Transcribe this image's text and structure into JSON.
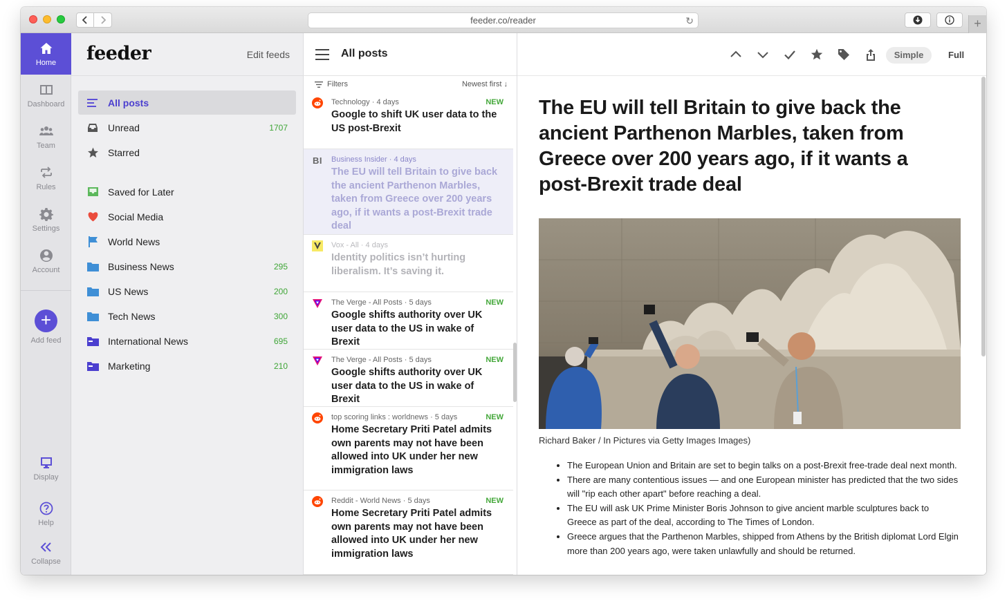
{
  "browser": {
    "url": "feeder.co/reader"
  },
  "rail": {
    "items": [
      {
        "label": "Home",
        "icon": "home-icon"
      },
      {
        "label": "Dashboard",
        "icon": "dashboard-icon"
      },
      {
        "label": "Team",
        "icon": "team-icon"
      },
      {
        "label": "Rules",
        "icon": "rules-icon"
      },
      {
        "label": "Settings",
        "icon": "gear-icon"
      },
      {
        "label": "Account",
        "icon": "account-icon"
      }
    ],
    "add_feed": "Add feed",
    "bottom": [
      {
        "label": "Display",
        "icon": "monitor-icon"
      },
      {
        "label": "Help",
        "icon": "help-icon"
      },
      {
        "label": "Collapse",
        "icon": "double-chevron-left-icon"
      }
    ]
  },
  "sidebar": {
    "logo": "feeder",
    "edit_feeds": "Edit feeds",
    "items": [
      {
        "label": "All posts",
        "count": "",
        "icon": "all-posts-icon"
      },
      {
        "label": "Unread",
        "count": "1707",
        "icon": "inbox-icon"
      },
      {
        "label": "Starred",
        "count": "",
        "icon": "star-icon"
      },
      {
        "label": "Saved for Later",
        "count": "",
        "icon": "saved-tray-icon"
      },
      {
        "label": "Social Media",
        "count": "",
        "icon": "heart-icon"
      },
      {
        "label": "World News",
        "count": "",
        "icon": "flag-icon"
      },
      {
        "label": "Business News",
        "count": "295",
        "icon": "folder-icon"
      },
      {
        "label": "US News",
        "count": "200",
        "icon": "folder-icon"
      },
      {
        "label": "Tech News",
        "count": "300",
        "icon": "folder-icon"
      },
      {
        "label": "International News",
        "count": "695",
        "icon": "folder-dark-icon"
      },
      {
        "label": "Marketing",
        "count": "210",
        "icon": "folder-dark-icon"
      }
    ],
    "colors": {
      "accent": "#5c4fd6",
      "count": "#3ea536"
    }
  },
  "posts": {
    "title": "All posts",
    "filters": "Filters",
    "sort": "Newest first ↓",
    "new_label": "NEW",
    "items": [
      {
        "source": "Technology",
        "age": "4 days",
        "is_new": true,
        "title": "Google to shift UK user data to the US post-Brexit",
        "icon": "reddit-icon"
      },
      {
        "source": "Business Insider",
        "age": "4 days",
        "is_new": false,
        "title": "The EU will tell Britain to give back the ancient Parthenon Marbles, taken from Greece over 200 years ago, if it wants a post-Brexit trade deal",
        "icon": "business-insider-icon"
      },
      {
        "source": "Vox - All",
        "age": "4 days",
        "is_new": false,
        "title": "Identity politics isn’t hurting liberalism. It’s saving it.",
        "icon": "vox-icon"
      },
      {
        "source": "The Verge - All Posts",
        "age": "5 days",
        "is_new": true,
        "title": "Google shifts authority over UK user data to the US in wake of Brexit",
        "icon": "verge-icon"
      },
      {
        "source": "The Verge - All Posts",
        "age": "5 days",
        "is_new": true,
        "title": "Google shifts authority over UK user data to the US in wake of Brexit",
        "icon": "verge-icon"
      },
      {
        "source": "top scoring links : worldnews",
        "age": "5 days",
        "is_new": true,
        "title": "Home Secretary Priti Patel admits own parents may not have been allowed into UK under her new immigration laws",
        "icon": "reddit-icon"
      },
      {
        "source": "Reddit - World News",
        "age": "5 days",
        "is_new": true,
        "title": "Home Secretary Priti Patel admits own parents may not have been allowed into UK under her new immigration laws",
        "icon": "reddit-icon"
      }
    ]
  },
  "reader": {
    "mode_simple": "Simple",
    "mode_full": "Full",
    "title": "The EU will tell Britain to give back the ancient Parthenon Marbles, taken from Greece over 200 years ago, if it wants a post-Brexit trade deal",
    "caption": "Richard Baker / In Pictures via Getty Images Images)",
    "bullets": [
      "The European Union and Britain are set to begin talks on a post-Brexit free-trade deal next month.",
      "There are many contentious issues — and one European minister has predicted that the two sides will \"rip each other apart\" before reaching a deal.",
      "The EU will ask UK Prime Minister Boris Johnson to give ancient marble sculptures back to Greece as part of the deal, according to The Times of London.",
      "Greece argues that the Parthenon Marbles, shipped from Athens by the British diplomat Lord Elgin more than 200 years ago, were taken unlawfully and should be returned."
    ]
  }
}
